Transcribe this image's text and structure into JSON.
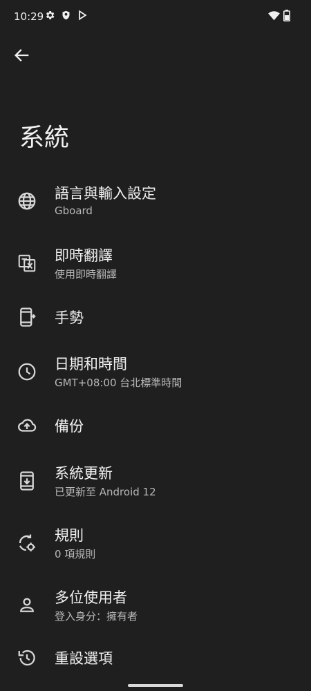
{
  "status": {
    "time": "10:29"
  },
  "header": {
    "title": "系統",
    "back_label": "返回"
  },
  "items": [
    {
      "title": "語言與輸入設定",
      "subtitle": "Gboard",
      "icon": "globe-icon"
    },
    {
      "title": "即時翻譯",
      "subtitle": "使用即時翻譯",
      "icon": "translate-icon"
    },
    {
      "title": "手勢",
      "subtitle": "",
      "icon": "phone-gesture-icon"
    },
    {
      "title": "日期和時間",
      "subtitle": "GMT+08:00 台北標準時間",
      "icon": "clock-icon"
    },
    {
      "title": "備份",
      "subtitle": "",
      "icon": "cloud-upload-icon"
    },
    {
      "title": "系統更新",
      "subtitle": "已更新至 Android 12",
      "icon": "system-update-icon"
    },
    {
      "title": "規則",
      "subtitle": "0 項規則",
      "icon": "rules-icon"
    },
    {
      "title": "多位使用者",
      "subtitle": "登入身分：擁有者",
      "icon": "person-icon"
    },
    {
      "title": "重設選項",
      "subtitle": "",
      "icon": "history-icon"
    }
  ]
}
